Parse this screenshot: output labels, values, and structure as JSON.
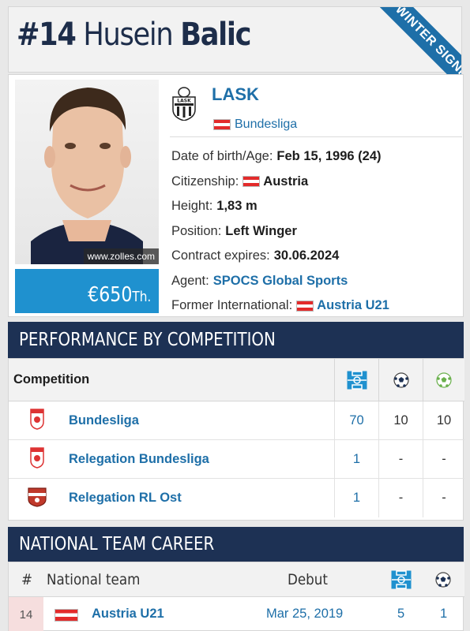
{
  "player": {
    "number": "#14",
    "first_name": "Husein",
    "last_name": "Balic",
    "badge": "WINTER SIGNING",
    "photo_credit": "www.zolles.com",
    "market_value": "€650",
    "market_value_unit": "Th."
  },
  "club": {
    "name": "LASK",
    "league": "Bundesliga",
    "logo_text": "LASK"
  },
  "info": {
    "dob_label": "Date of birth/Age:",
    "dob_value": "Feb 15, 1996 (24)",
    "citizenship_label": "Citizenship:",
    "citizenship_value": "Austria",
    "height_label": "Height:",
    "height_value": "1,83 m",
    "position_label": "Position:",
    "position_value": "Left Winger",
    "contract_label": "Contract expires:",
    "contract_value": "30.06.2024",
    "agent_label": "Agent:",
    "agent_value": "SPOCS Global Sports",
    "former_int_label": "Former International:",
    "former_int_value": "Austria U21"
  },
  "performance": {
    "title": "PERFORMANCE BY COMPETITION",
    "col_competition": "Competition",
    "icons": [
      "pitch-icon",
      "goal-ball-icon",
      "assist-ball-icon"
    ],
    "rows": [
      {
        "competition": "Bundesliga",
        "apps": "70",
        "goals": "10",
        "assists": "10"
      },
      {
        "competition": "Relegation Bundesliga",
        "apps": "1",
        "goals": "-",
        "assists": "-"
      },
      {
        "competition": "Relegation RL Ost",
        "apps": "1",
        "goals": "-",
        "assists": "-"
      }
    ]
  },
  "national": {
    "title": "NATIONAL TEAM CAREER",
    "col_number": "#",
    "col_team": "National team",
    "col_debut": "Debut",
    "rows": [
      {
        "number": "14",
        "team": "Austria U21",
        "debut": "Mar 25, 2019",
        "caps": "5",
        "goals": "1"
      }
    ]
  },
  "colors": {
    "navy": "#1d3154",
    "link_blue": "#1e6fa8",
    "value_blue": "#1f91cf",
    "austria_red": "#e32b2b"
  }
}
